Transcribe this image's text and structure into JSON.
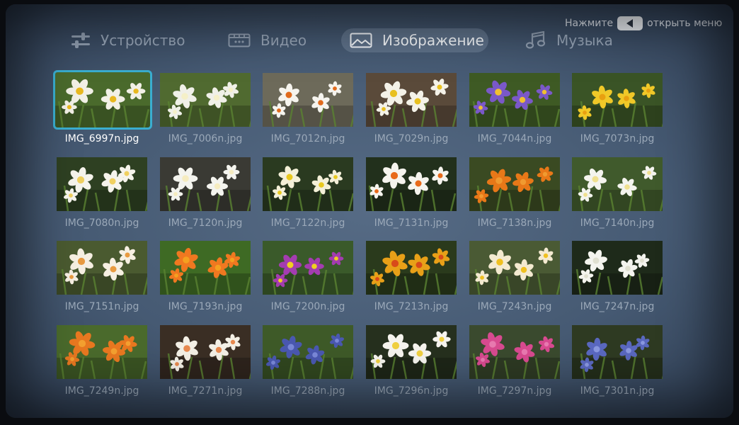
{
  "hint": {
    "before": "Нажмите",
    "after": "открыть меню"
  },
  "tabs": [
    {
      "label": "Устройство",
      "icon": "sliders-icon",
      "active": false
    },
    {
      "label": "Видео",
      "icon": "film-icon",
      "active": false
    },
    {
      "label": "Изображение",
      "icon": "image-icon",
      "active": true
    },
    {
      "label": "Музыка",
      "icon": "music-note-icon",
      "active": false
    }
  ],
  "files": [
    {
      "name": "IMG_6997n.jpg",
      "bg": "#4a6a2c",
      "a": "#f2f0e6",
      "b": "#e8b820",
      "focused": true
    },
    {
      "name": "IMG_7006n.jpg",
      "bg": "#506a30",
      "a": "#f0f0e8",
      "b": "#f5f0c8"
    },
    {
      "name": "IMG_7012n.jpg",
      "bg": "#6d6a5a",
      "a": "#f6f4ee",
      "b": "#e06a1c"
    },
    {
      "name": "IMG_7029n.jpg",
      "bg": "#5a4a3a",
      "a": "#f4f2e8",
      "b": "#e8c020"
    },
    {
      "name": "IMG_7044n.jpg",
      "bg": "#3e5a24",
      "a": "#7a58c8",
      "b": "#f0c030"
    },
    {
      "name": "IMG_7073n.jpg",
      "bg": "#3a5426",
      "a": "#f0c828",
      "b": "#e8a010"
    },
    {
      "name": "IMG_7080n.jpg",
      "bg": "#2e4022",
      "a": "#f6f4ec",
      "b": "#f0d060"
    },
    {
      "name": "IMG_7120n.jpg",
      "bg": "#3a3a34",
      "a": "#f4f4ee",
      "b": "#f6ecc0"
    },
    {
      "name": "IMG_7122n.jpg",
      "bg": "#2a3a20",
      "a": "#f4f0d8",
      "b": "#e8c81e"
    },
    {
      "name": "IMG_7131n.jpg",
      "bg": "#22301c",
      "a": "#f6f4ee",
      "b": "#e86a1a"
    },
    {
      "name": "IMG_7138n.jpg",
      "bg": "#3a4a22",
      "a": "#e87818",
      "b": "#f09a30"
    },
    {
      "name": "IMG_7140n.jpg",
      "bg": "#405a2c",
      "a": "#f4f4ee",
      "b": "#f0e090"
    },
    {
      "name": "IMG_7151n.jpg",
      "bg": "#4a5a30",
      "a": "#f6efe2",
      "b": "#e89a40"
    },
    {
      "name": "IMG_7193n.jpg",
      "bg": "#3e6a24",
      "a": "#f07820",
      "b": "#f4a020"
    },
    {
      "name": "IMG_7200n.jpg",
      "bg": "#3a5a2a",
      "a": "#a43cb0",
      "b": "#f0d020"
    },
    {
      "name": "IMG_7213n.jpg",
      "bg": "#2a3a1c",
      "a": "#e8a018",
      "b": "#d84a1a"
    },
    {
      "name": "IMG_7243n.jpg",
      "bg": "#4a5a34",
      "a": "#f4ead0",
      "b": "#f0c020"
    },
    {
      "name": "IMG_7247n.jpg",
      "bg": "#1e2a1a",
      "a": "#f4f4ee",
      "b": "#e0e0d0"
    },
    {
      "name": "IMG_7249n.jpg",
      "bg": "#4a6a2c",
      "a": "#e87820",
      "b": "#f4a030"
    },
    {
      "name": "IMG_7271n.jpg",
      "bg": "#3a2e24",
      "a": "#f4f0e6",
      "b": "#e88a50"
    },
    {
      "name": "IMG_7288n.jpg",
      "bg": "#3e5a28",
      "a": "#4a58b0",
      "b": "#7a88d8"
    },
    {
      "name": "IMG_7296n.jpg",
      "bg": "#26301e",
      "a": "#f6f4ee",
      "b": "#f0d040"
    },
    {
      "name": "IMG_7297n.jpg",
      "bg": "#3a4a2e",
      "a": "#d84a90",
      "b": "#e87ab0"
    },
    {
      "name": "IMG_7301n.jpg",
      "bg": "#2e3a22",
      "a": "#5a68c0",
      "b": "#8a98e0"
    }
  ]
}
